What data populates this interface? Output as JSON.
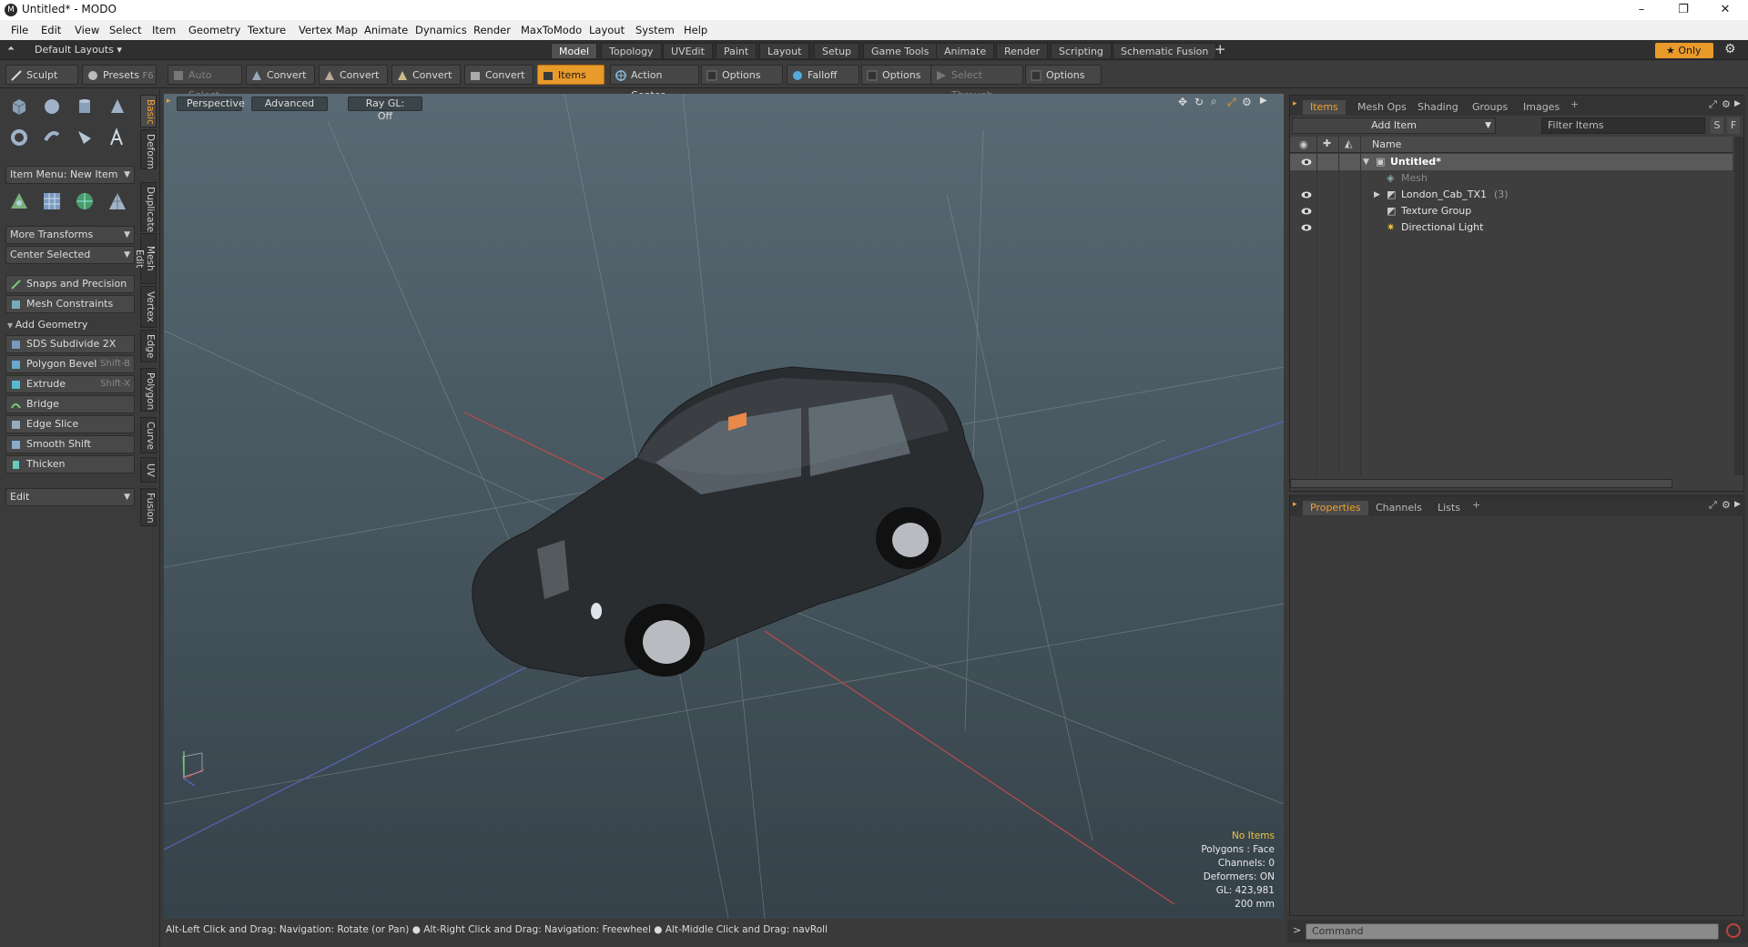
{
  "window": {
    "title": "Untitled* - MODO",
    "logo": "M",
    "minimize": "–",
    "maximize": "❐",
    "close": "✕"
  },
  "menu": [
    "File",
    "Edit",
    "View",
    "Select",
    "Item",
    "Geometry",
    "Texture",
    "Vertex Map",
    "Animate",
    "Dynamics",
    "Render",
    "MaxToModo",
    "Layout",
    "System",
    "Help"
  ],
  "modebar": {
    "layouts": "Default Layouts",
    "tabs": [
      "Model",
      "Topology",
      "UVEdit",
      "Paint",
      "Layout",
      "Setup",
      "Game Tools",
      "Animate",
      "Render",
      "Scripting",
      "Schematic Fusion"
    ],
    "active": "Model",
    "plus": "+",
    "only": "Only"
  },
  "toolbar": {
    "sculpt": "Sculpt",
    "presets": "Presets",
    "presets_key": "F6",
    "auto_select": "Auto Select",
    "convert1": "Convert",
    "convert2": "Convert",
    "convert3": "Convert",
    "convert4": "Convert",
    "items": "Items",
    "action_center": "Action Center",
    "options1": "Options",
    "falloff": "Falloff",
    "options2": "Options",
    "select_through": "Select Through",
    "options3": "Options"
  },
  "leftpanel": {
    "item_menu": "Item Menu: New Item",
    "more_transforms": "More Transforms",
    "center_selected": "Center Selected",
    "snaps": "Snaps and Precision",
    "mesh_constraints": "Mesh Constraints",
    "add_geometry": "Add Geometry",
    "tools": [
      {
        "label": "SDS Subdivide 2X",
        "shortcut": ""
      },
      {
        "label": "Polygon Bevel",
        "shortcut": "Shift-B"
      },
      {
        "label": "Extrude",
        "shortcut": "Shift-X"
      },
      {
        "label": "Bridge",
        "shortcut": ""
      },
      {
        "label": "Edge Slice",
        "shortcut": ""
      },
      {
        "label": "Smooth Shift",
        "shortcut": ""
      },
      {
        "label": "Thicken",
        "shortcut": ""
      }
    ],
    "edit": "Edit"
  },
  "sidetabs": [
    "Basic",
    "Deform",
    "Duplicate",
    "Mesh Edit",
    "Vertex",
    "Edge",
    "Polygon",
    "Curve",
    "UV",
    "Fusion"
  ],
  "viewport": {
    "perspective": "Perspective",
    "advanced": "Advanced",
    "raygl": "Ray GL: Off",
    "info": {
      "no_items": "No Items",
      "polygons": "Polygons : Face",
      "channels": "Channels: 0",
      "deformers": "Deformers: ON",
      "gl": "GL: 423,981",
      "scale": "200 mm"
    }
  },
  "statusline": "Alt-Left Click and Drag: Navigation: Rotate (or Pan) ● Alt-Right Click and Drag: Navigation: Freewheel ● Alt-Middle Click and Drag: navRoll",
  "items_panel": {
    "tabs": [
      "Items",
      "Mesh Ops",
      "Shading",
      "Groups",
      "Images"
    ],
    "plus": "+",
    "add_item": "Add Item",
    "filter": "Filter Items",
    "s": "S",
    "f": "F",
    "name_col": "Name",
    "rows": [
      {
        "label": "Untitled*",
        "extra": ""
      },
      {
        "label": "Mesh",
        "extra": ""
      },
      {
        "label": "London_Cab_TX1",
        "extra": "(3)"
      },
      {
        "label": "Texture Group",
        "extra": ""
      },
      {
        "label": "Directional Light",
        "extra": ""
      }
    ]
  },
  "props_panel": {
    "tabs": [
      "Properties",
      "Channels",
      "Lists"
    ],
    "plus": "+"
  },
  "command": {
    "placeholder": "Command",
    "prompt": ">"
  },
  "colors": {
    "accent": "#f0a030",
    "viewport_top": "#5a6a74",
    "viewport_bottom": "#36424a"
  }
}
